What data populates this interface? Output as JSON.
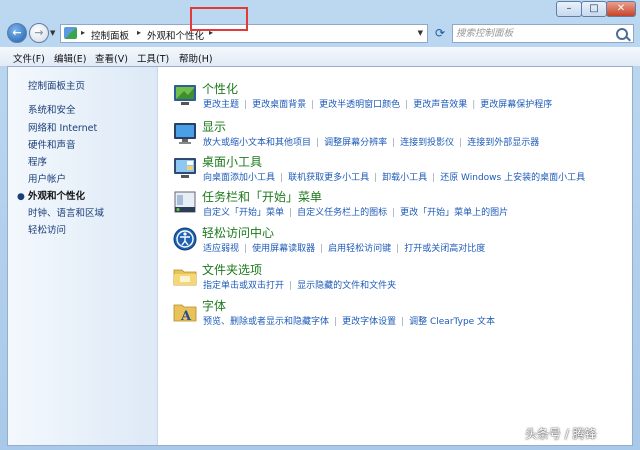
{
  "addressbar": {
    "crumbs": [
      "控制面板",
      "外观和个性化"
    ],
    "search_placeholder": "搜索控制面板"
  },
  "menu": [
    "文件(F)",
    "编辑(E)",
    "查看(V)",
    "工具(T)",
    "帮助(H)"
  ],
  "sidebar": {
    "items": [
      "控制面板主页",
      "系统和安全",
      "网络和 Internet",
      "硬件和声音",
      "程序",
      "用户帐户",
      "外观和个性化",
      "时钟、语言和区域",
      "轻松访问"
    ],
    "active_index": 6
  },
  "categories": [
    {
      "title": "个性化",
      "icon": "personalization-icon",
      "links": [
        "更改主题",
        "更改桌面背景",
        "更改半透明窗口颜色",
        "更改声音效果",
        "更改屏幕保护程序"
      ]
    },
    {
      "title": "显示",
      "icon": "display-icon",
      "links": [
        "放大或缩小文本和其他项目",
        "调整屏幕分辨率",
        "连接到投影仪",
        "连接到外部显示器"
      ]
    },
    {
      "title": "桌面小工具",
      "icon": "gadgets-icon",
      "links": [
        "向桌面添加小工具",
        "联机获取更多小工具",
        "卸载小工具",
        "还原 Windows 上安装的桌面小工具"
      ]
    },
    {
      "title": "任务栏和「开始」菜单",
      "icon": "taskbar-icon",
      "links": [
        "自定义「开始」菜单",
        "自定义任务栏上的图标",
        "更改「开始」菜单上的图片"
      ]
    },
    {
      "title": "轻松访问中心",
      "icon": "ease-of-access-icon",
      "links": [
        "适应弱视",
        "使用屏幕读取器",
        "启用轻松访问键",
        "打开或关闭高对比度"
      ]
    },
    {
      "title": "文件夹选项",
      "icon": "folder-options-icon",
      "links": [
        "指定单击或双击打开",
        "显示隐藏的文件和文件夹"
      ]
    },
    {
      "title": "字体",
      "icon": "fonts-icon",
      "links": [
        "预览、删除或者显示和隐藏字体",
        "更改字体设置",
        "调整 ClearType 文本"
      ]
    }
  ],
  "watermark": "头条号 / 腾锋",
  "colors": {
    "link": "#1e5bb8",
    "category_title": "#1d7a1d",
    "highlight_box": "#e23a3a"
  }
}
